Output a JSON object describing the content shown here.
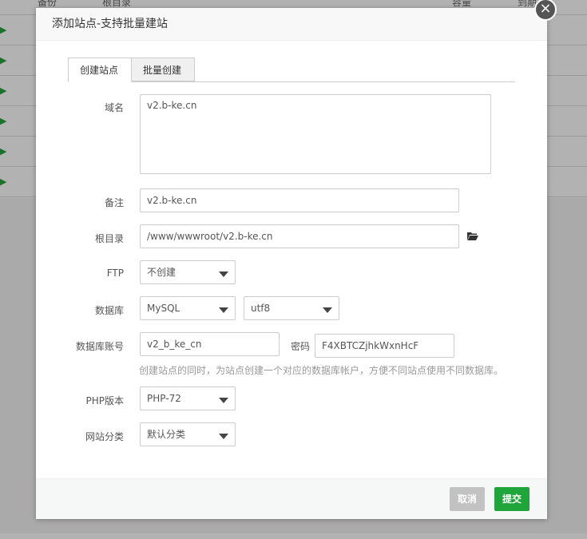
{
  "background": {
    "headers": [
      "备份",
      "根目录",
      "容量",
      "到期"
    ],
    "row_arrow": "▶"
  },
  "dialog": {
    "title": "添加站点-支持批量建站",
    "close_symbol": "×",
    "tabs": [
      {
        "label": "创建站点",
        "active": true
      },
      {
        "label": "批量创建",
        "active": false
      }
    ]
  },
  "form": {
    "domain": {
      "label": "域名",
      "value": "v2.b-ke.cn"
    },
    "remark": {
      "label": "备注",
      "value": "v2.b-ke.cn"
    },
    "root_dir": {
      "label": "根目录",
      "value": "/www/wwwroot/v2.b-ke.cn"
    },
    "ftp": {
      "label": "FTP",
      "selected": "不创建"
    },
    "database": {
      "label": "数据库",
      "selected": "MySQL",
      "charset": "utf8"
    },
    "db_account": {
      "label": "数据库账号",
      "value": "v2_b_ke_cn",
      "password_label": "密码",
      "password_value": "F4XBTCZjhkWxnHcF"
    },
    "db_help": "创建站点的同时，为站点创建一个对应的数据库帐户，方便不同站点使用不同数据库。",
    "php_version": {
      "label": "PHP版本",
      "selected": "PHP-72"
    },
    "category": {
      "label": "网站分类",
      "selected": "默认分类"
    }
  },
  "footer": {
    "cancel_label": "取消",
    "submit_label": "提交"
  },
  "colors": {
    "accent": "#20a53a",
    "cancel": "#c2c2c2"
  }
}
